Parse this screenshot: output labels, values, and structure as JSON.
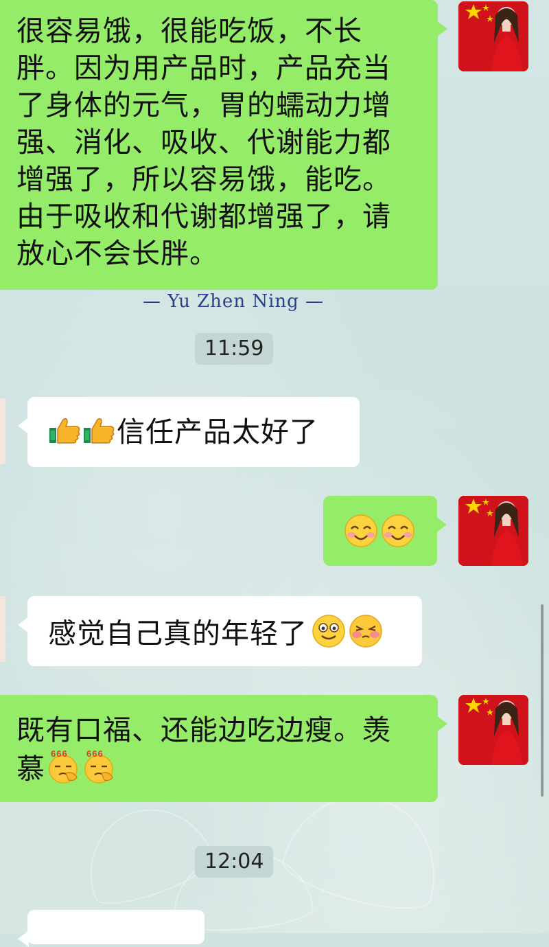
{
  "messages": {
    "m1_text": "很容易饿，很能吃饭，不长胖。因为用产品时，产品充当了身体的元气，胃的蠕动力增强、消化、吸收、代谢能力都增强了，所以容易饿，能吃。由于吸收和代谢都增强了，请放心不会长胖。",
    "m1_lines": [
      "很容易饿，很能吃饭，不长",
      "胖。因为用产品时，产品充当",
      "了身体的元气，胃的蠕动力增",
      "强、消化、吸收、代谢能力都",
      "增强了，所以容易饿，能吃。",
      "由于吸收和代谢都增强了，请",
      "放心不会长胖。"
    ],
    "signature": "— Yu Zhen Ning —",
    "time1": "11:59",
    "m2_text": "信任产品太好了",
    "m4_text": "感觉自己真的年轻了",
    "m5_line1": "既有口福、还能边吃边瘦。羡",
    "m5_line2": "慕",
    "emoji_666_label": "666",
    "time2": "12:04"
  },
  "colors": {
    "outgoing_bubble": "#95ec69",
    "incoming_bubble": "#ffffff",
    "background": "#cfe3e1",
    "signature": "#2e3f8a"
  },
  "icons": {
    "thumbs_up": "thumbs-up-icon",
    "smile": "smile-emoji-icon",
    "grin": "grin-emoji-icon",
    "shy": "shy-emoji-icon",
    "666": "666-emoji-icon"
  }
}
